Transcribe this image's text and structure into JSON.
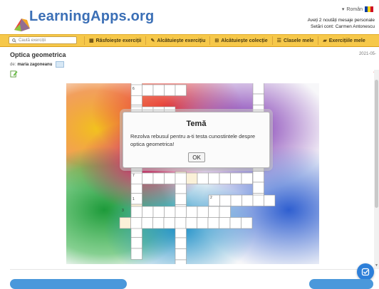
{
  "header": {
    "logo_text": "LearningApps.org",
    "language": "Român",
    "messages_line": "Aveți 2 noutăți mesaje personale",
    "settings_line": "Setări cont: Carmen Antonescu"
  },
  "nav": {
    "search_placeholder": "Caută exerciții",
    "items": [
      {
        "label": "Răsfoiește exerciții",
        "icon": "grid-icon"
      },
      {
        "label": "Alcătuiește exercițiu",
        "icon": "pencil-icon"
      },
      {
        "label": "Alcătuiește colecție",
        "icon": "collection-icon"
      },
      {
        "label": "Clasele mele",
        "icon": "list-icon"
      },
      {
        "label": "Exercițiile mele",
        "icon": "folder-icon"
      }
    ]
  },
  "page": {
    "title": "Optica geometrica",
    "date": "2021-05-",
    "author_prefix": "de:",
    "author": "maria zagoneanu"
  },
  "dialog": {
    "title": "Temă",
    "text": "Rezolva rebusul pentru a-ti testa cunostintele despre optica geometrica!",
    "ok_label": "OK"
  },
  "crossword": {
    "clue_numbers": [
      "6",
      "7",
      "1",
      "2",
      "3"
    ]
  },
  "colors": {
    "nav_bg": "#f6c84a",
    "accent_blue": "#2d7fd9",
    "logo_blue": "#3b6fb6"
  }
}
